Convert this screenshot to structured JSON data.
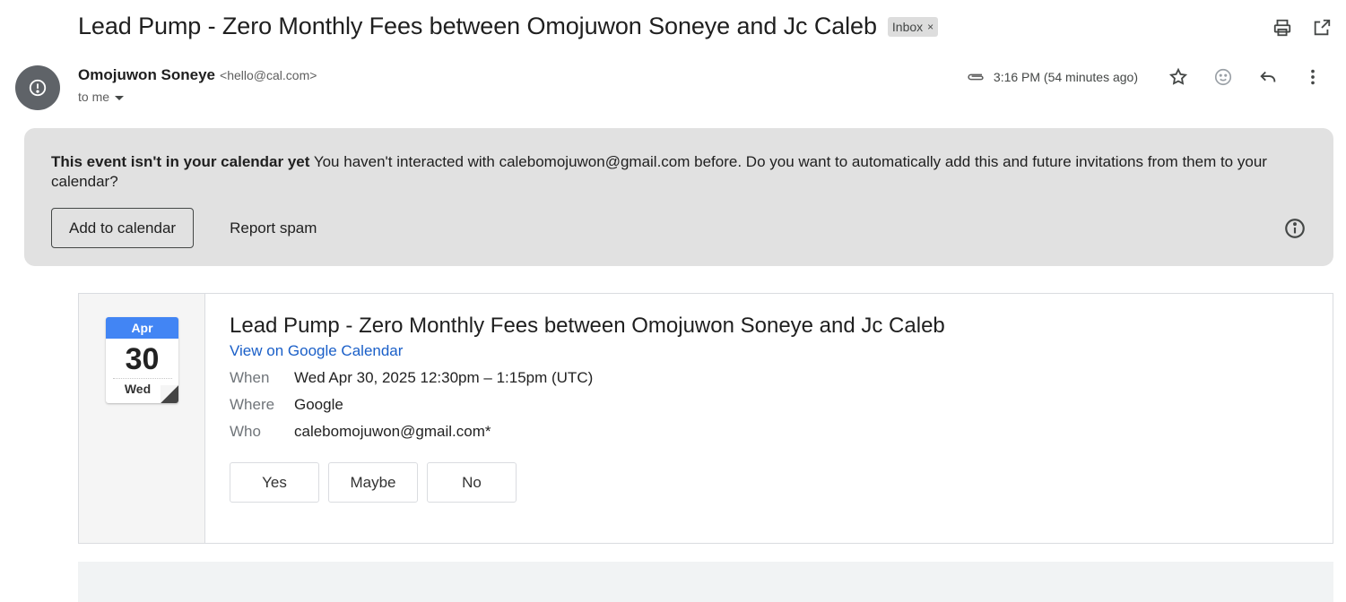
{
  "header": {
    "subject": "Lead Pump - Zero Monthly Fees between Omojuwon Soneye and Jc Caleb",
    "label": "Inbox",
    "label_remove": "×"
  },
  "top_actions": {
    "print_icon": "printer-icon",
    "popout_icon": "open-in-new-window-icon"
  },
  "sender": {
    "name": "Omojuwon Soneye",
    "email": "<hello@cal.com>",
    "to": "to me",
    "avatar_icon": "alert-icon"
  },
  "meta": {
    "time": "3:16 PM (54 minutes ago)",
    "attachment_icon": "paperclip-icon",
    "star_icon": "star-icon",
    "emoji_icon": "emoji-icon",
    "reply_icon": "reply-icon",
    "more_icon": "more-vert-icon"
  },
  "banner": {
    "bold": "This event isn't in your calendar yet",
    "text": " You haven't interacted with calebomojuwon@gmail.com before. Do you want to automatically add this and future invitations from them to your calendar?",
    "add_button": "Add to calendar",
    "spam_button": "Report spam",
    "info_icon": "info-icon"
  },
  "invite": {
    "month": "Apr",
    "day": "30",
    "weekday": "Wed",
    "title": "Lead Pump - Zero Monthly Fees between Omojuwon Soneye and Jc Caleb",
    "link": "View on Google Calendar",
    "rows": [
      {
        "key": "When",
        "value": "Wed Apr 30, 2025 12:30pm – 1:15pm (UTC)"
      },
      {
        "key": "Where",
        "value": "Google"
      },
      {
        "key": "Who",
        "value": "calebomojuwon@gmail.com*"
      }
    ],
    "rsvp": {
      "yes": "Yes",
      "maybe": "Maybe",
      "no": "No"
    }
  },
  "colors": {
    "accent": "#4285f4",
    "link": "#1a5fc8",
    "banner_bg": "#e1e1e1"
  }
}
